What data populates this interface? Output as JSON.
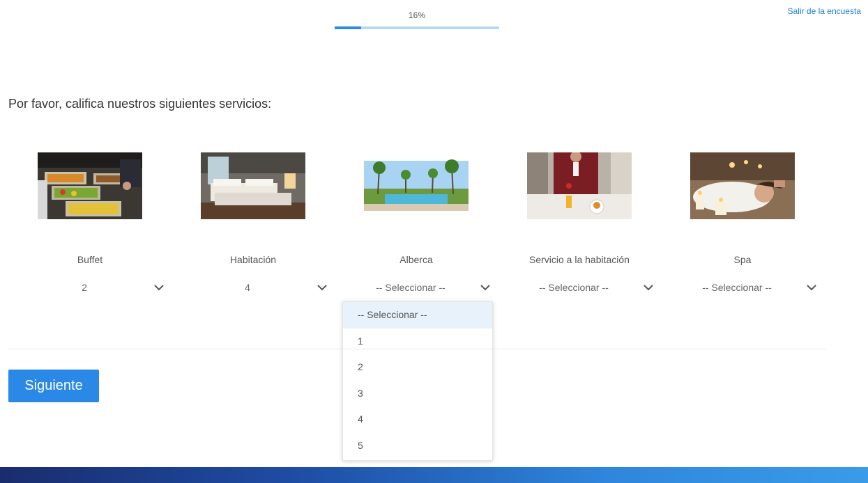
{
  "progress": {
    "text": "16%",
    "value": 0.16
  },
  "header": {
    "exit_link": "Salir de la encuesta"
  },
  "survey": {
    "question": "Por favor, califica nuestros siguientes servicios:",
    "services": [
      {
        "label": "Buffet",
        "selected": "2",
        "image": "buffet-photo"
      },
      {
        "label": "Habitación",
        "selected": "4",
        "image": "hotel-room-photo"
      },
      {
        "label": "Alberca",
        "selected": "-- Seleccionar --",
        "image": "pool-photo"
      },
      {
        "label": "Servicio a la habitación",
        "selected": "-- Seleccionar --",
        "image": "room-service-photo"
      },
      {
        "label": "Spa",
        "selected": "-- Seleccionar --",
        "image": "spa-photo"
      }
    ],
    "open_dropdown": {
      "for": "Alberca",
      "options": [
        "-- Seleccionar --",
        "1",
        "2",
        "3",
        "4",
        "5"
      ],
      "highlighted": "-- Seleccionar --"
    }
  },
  "actions": {
    "next_label": "Siguiente"
  },
  "colors": {
    "accent": "#2a88e6",
    "link": "#1e7fd6",
    "progress_fill": "#2f8ae0",
    "progress_track": "#b7d8f1"
  }
}
